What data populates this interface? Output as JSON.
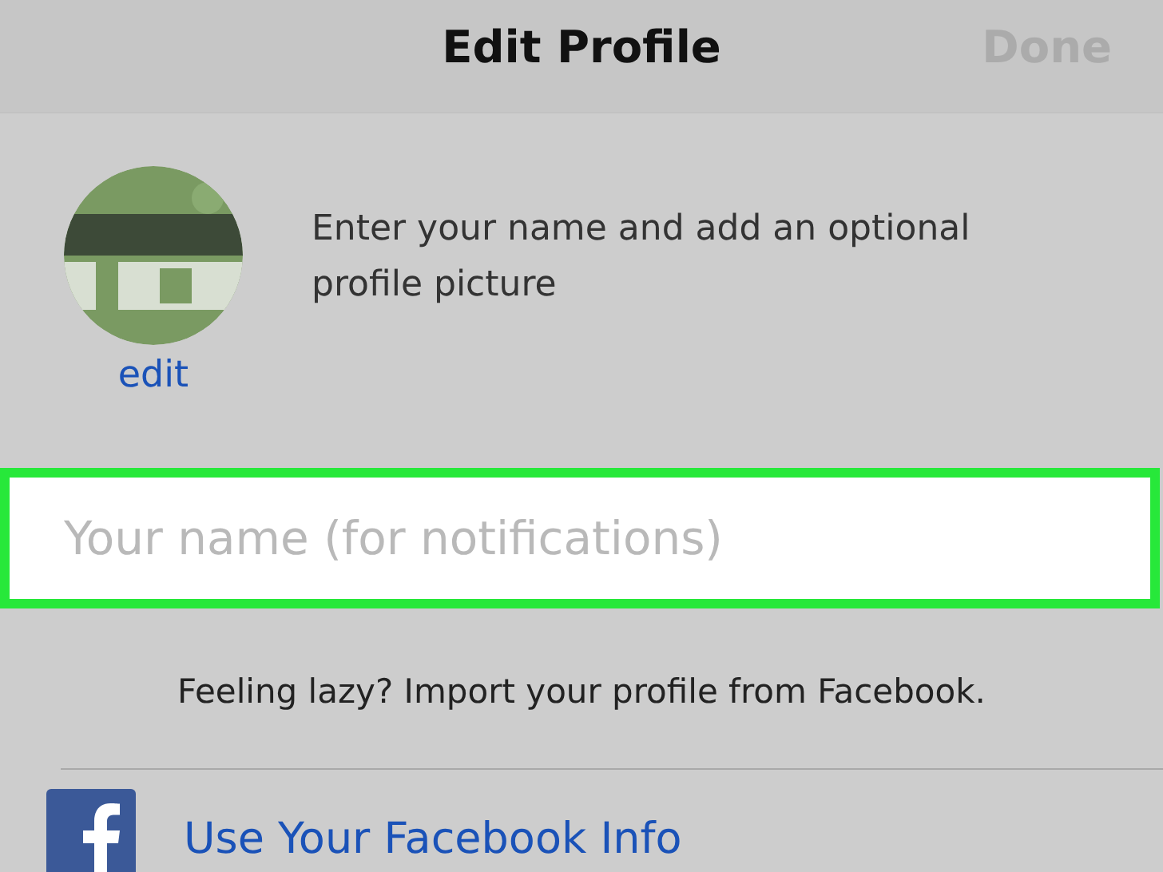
{
  "nav_bar": {
    "title": "Edit Profile",
    "done_button": {
      "label": "Done",
      "disabled": true
    }
  },
  "profile": {
    "edit_link": "edit",
    "hint": "Enter your name and add an optional profile picture"
  },
  "name_field": {
    "placeholder": "Your name (for notifications)"
  },
  "import_hint": "Feeling lazy? Import your profile from Facebook.",
  "facebook_button": {
    "label": "Use Your Facebook Info"
  }
}
